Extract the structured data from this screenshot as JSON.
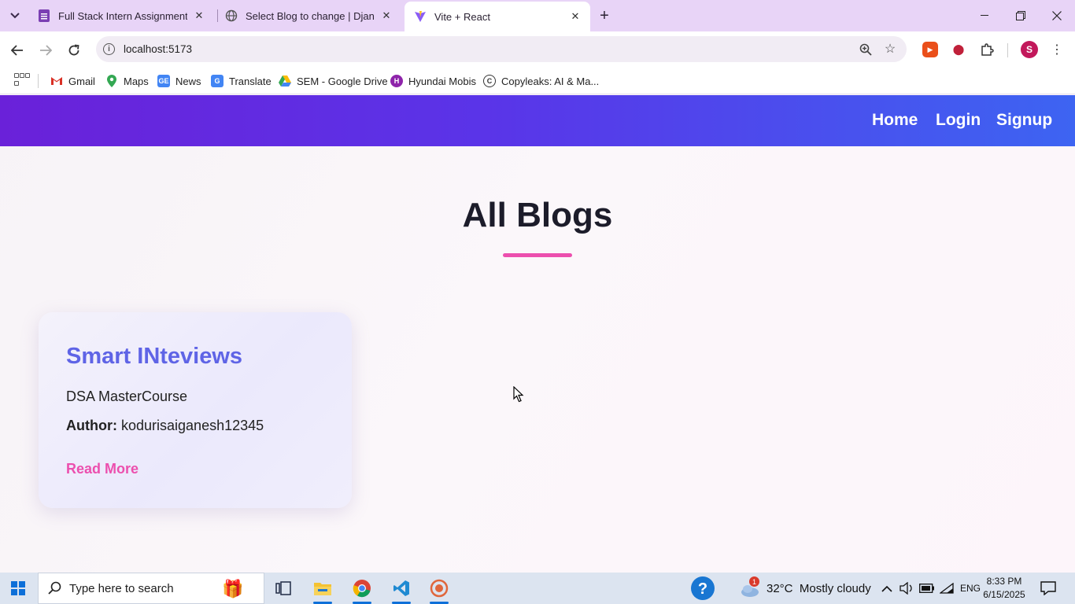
{
  "browser": {
    "tabs": [
      {
        "label": "Full Stack Intern Assignment Su",
        "active": false
      },
      {
        "label": "Select Blog to change | Django",
        "active": false
      },
      {
        "label": "Vite + React",
        "active": true
      }
    ],
    "url": "localhost:5173",
    "profile_initial": "S",
    "bookmarks": [
      {
        "label": "Gmail",
        "icon": "gmail-icon"
      },
      {
        "label": "Maps",
        "icon": "maps-icon"
      },
      {
        "label": "News",
        "icon": "news-icon"
      },
      {
        "label": "Translate",
        "icon": "translate-icon"
      },
      {
        "label": "SEM - Google Drive",
        "icon": "drive-icon"
      },
      {
        "label": "Hyundai Mobis",
        "icon": "hyundai-icon"
      },
      {
        "label": "Copyleaks: AI & Ma...",
        "icon": "copyleaks-icon"
      }
    ]
  },
  "site": {
    "nav": {
      "home": "Home",
      "login": "Login",
      "signup": "Signup"
    },
    "page_title": "All Blogs",
    "blogs": [
      {
        "title": "Smart INteviews",
        "subtitle": "DSA MasterCourse",
        "author_label": "Author:",
        "author": "kodurisaiganesh12345",
        "read_more": "Read More"
      }
    ],
    "colors": {
      "nav_gradient_start": "#6a21d9",
      "nav_gradient_end": "#3d64f2",
      "accent_pink": "#ec4fae",
      "card_title": "#5f64e6"
    }
  },
  "taskbar": {
    "search_placeholder": "Type here to search",
    "weather": "32°C  Mostly cloudy",
    "weather_badge": "1",
    "language": "ENG",
    "time": "8:33 PM",
    "date": "6/15/2025"
  }
}
